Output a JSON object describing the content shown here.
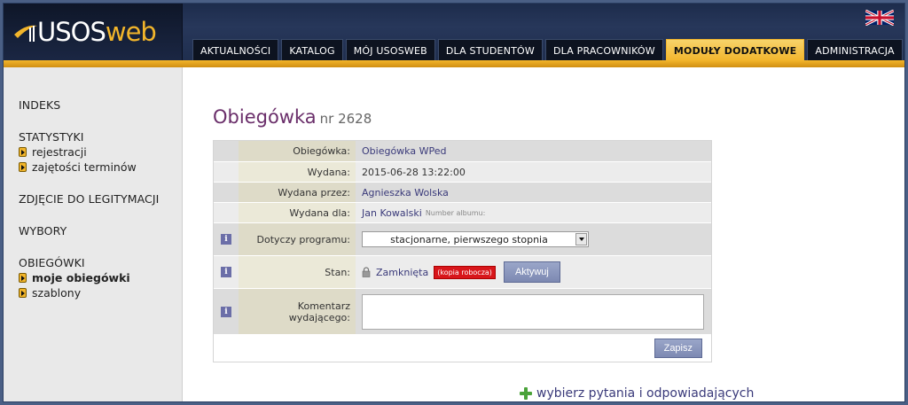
{
  "header": {
    "logo_prefix": "USOS",
    "logo_suffix": "web",
    "nav": [
      {
        "label": "AKTUALNOŚCI"
      },
      {
        "label": "KATALOG"
      },
      {
        "label": "MÓJ USOSWEB"
      },
      {
        "label": "DLA STUDENTÓW"
      },
      {
        "label": "DLA PRACOWNIKÓW"
      },
      {
        "label": "MODUŁY DODATKOWE",
        "active": true
      },
      {
        "label": "ADMINISTRACJA"
      }
    ],
    "flag_icon": "uk-flag-icon"
  },
  "sidebar": {
    "groups": [
      {
        "title": "INDEKS",
        "items": []
      },
      {
        "title": "STATYSTYKI",
        "items": [
          "rejestracji",
          "zajętości terminów"
        ]
      },
      {
        "title": "ZDJĘCIE DO LEGITYMACJI",
        "items": []
      },
      {
        "title": "WYBORY",
        "items": []
      },
      {
        "title": "OBIEGÓWKI",
        "items": [
          "moje obiegówki",
          "szablony"
        ]
      }
    ]
  },
  "main": {
    "title": "Obiegówka",
    "number": "nr 2628",
    "rows": {
      "obiegowka_label": "Obiegówka:",
      "obiegowka_value": "Obiegówka WPed",
      "wydana_label": "Wydana:",
      "wydana_value": "2015-06-28 13:22:00",
      "wydana_przez_label": "Wydana przez:",
      "wydana_przez_value": "Agnieszka Wolska",
      "wydana_dla_label": "Wydana dla:",
      "wydana_dla_value": "Jan Kowalski",
      "wydana_dla_note": "Number albumu:",
      "program_label": "Dotyczy programu:",
      "program_value": "stacjonarne, pierwszego stopnia",
      "stan_label": "Stan:",
      "stan_value": "Zamknięta",
      "stan_badge": "(kopia robocza)",
      "activate_label": "Aktywuj",
      "comment_label": "Komentarz wydającego:",
      "comment_value": "",
      "save_label": "Zapisz"
    },
    "bottom_link": "wybierz pytania i odpowiadających"
  },
  "colors": {
    "accent": "#f2b52b",
    "title": "#6a2e6a",
    "badge": "#d8161b"
  }
}
